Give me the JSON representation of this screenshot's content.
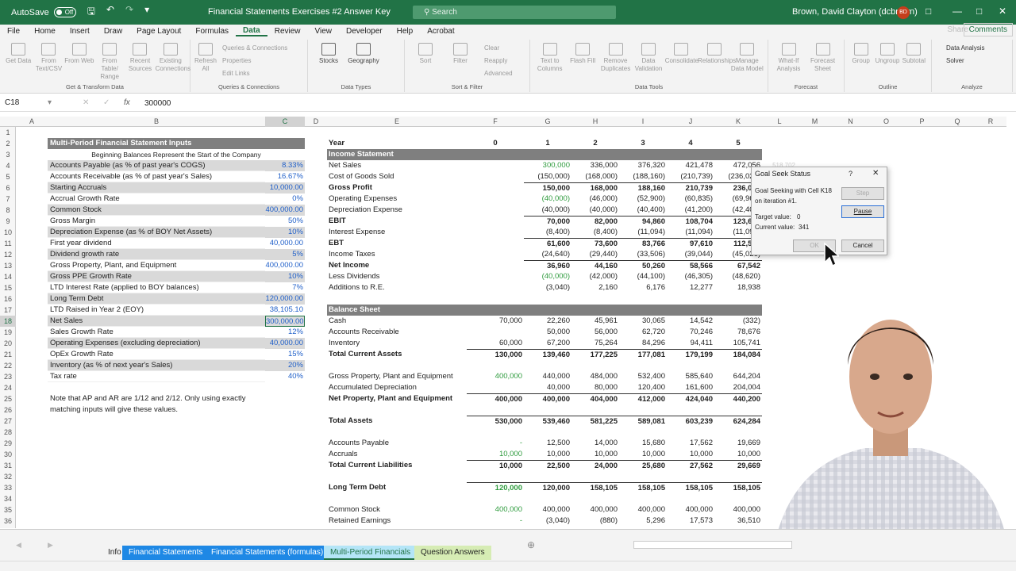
{
  "titlebar": {
    "autosave_label": "AutoSave",
    "autosave_state": "Off",
    "doc_title": "Financial Statements Exercises #2 Answer Key",
    "search_placeholder": "Search",
    "user_name": "Brown, David Clayton (dcbrown)",
    "user_initials": "BD"
  },
  "menu": {
    "items": [
      "File",
      "Home",
      "Insert",
      "Draw",
      "Page Layout",
      "Formulas",
      "Data",
      "Review",
      "View",
      "Developer",
      "Help",
      "Acrobat"
    ],
    "active": "Data",
    "share": "Share",
    "comments": "Comments"
  },
  "ribbon": {
    "get_transform": {
      "name": "Get & Transform Data",
      "buttons": [
        "Get Data",
        "From Text/CSV",
        "From Web",
        "From Table/ Range",
        "Recent Sources",
        "Existing Connections"
      ]
    },
    "queries": {
      "name": "Queries & Connections",
      "refresh": "Refresh All",
      "small": [
        "Queries & Connections",
        "Properties",
        "Edit Links"
      ]
    },
    "data_types": {
      "name": "Data Types",
      "buttons": [
        "Stocks",
        "Geography"
      ]
    },
    "sort_filter": {
      "name": "Sort & Filter",
      "buttons": [
        "Sort",
        "Filter"
      ],
      "small": [
        "Clear",
        "Reapply",
        "Advanced"
      ]
    },
    "data_tools": {
      "name": "Data Tools",
      "buttons": [
        "Text to Columns",
        "Flash Fill",
        "Remove Duplicates",
        "Data Validation",
        "Consolidate",
        "Relationships",
        "Manage Data Model"
      ]
    },
    "forecast": {
      "name": "Forecast",
      "buttons": [
        "What-If Analysis",
        "Forecast Sheet"
      ]
    },
    "outline": {
      "name": "Outline",
      "buttons": [
        "Group",
        "Ungroup",
        "Subtotal"
      ]
    },
    "analyze": {
      "name": "Analyze",
      "small": [
        "Data Analysis",
        "Solver"
      ]
    }
  },
  "formula_bar": {
    "name_box": "C18",
    "fx": "fx",
    "value": "300000"
  },
  "columns": [
    "A",
    "B",
    "C",
    "D",
    "E",
    "F",
    "G",
    "H",
    "I",
    "J",
    "K",
    "L",
    "M",
    "N",
    "O",
    "P",
    "Q",
    "R"
  ],
  "rows": [
    "1",
    "2",
    "3",
    "4",
    "5",
    "6",
    "7",
    "8",
    "9",
    "10",
    "11",
    "12",
    "13",
    "14",
    "15",
    "16",
    "17",
    "18",
    "19",
    "20",
    "21",
    "22",
    "23",
    "24",
    "25",
    "26",
    "27",
    "28",
    "29",
    "30",
    "31",
    "32",
    "33",
    "34",
    "35",
    "36"
  ],
  "inputs": {
    "title": "Multi-Period Financial Statement Inputs",
    "subtitle": "Beginning Balances Represent the Start of the Company",
    "rows": [
      {
        "label": "Accounts Payable (as % of past year's COGS)",
        "value": "8.33%"
      },
      {
        "label": "Accounts Receivable (as % of past year's Sales)",
        "value": "16.67%"
      },
      {
        "label": "Starting Accruals",
        "value": "10,000.00"
      },
      {
        "label": "Accrual Growth Rate",
        "value": "0%"
      },
      {
        "label": "Common Stock",
        "value": "400,000.00"
      },
      {
        "label": "Gross Margin",
        "value": "50%"
      },
      {
        "label": "Depreciation Expense (as % of BOY Net Assets)",
        "value": "10%"
      },
      {
        "label": "First year dividend",
        "value": "40,000.00"
      },
      {
        "label": "Dividend growth rate",
        "value": "5%"
      },
      {
        "label": "Gross Property, Plant, and Equipment",
        "value": "400,000.00"
      },
      {
        "label": "Gross PPE Growth Rate",
        "value": "10%"
      },
      {
        "label": "LTD Interest Rate (applied to BOY balances)",
        "value": "7%"
      },
      {
        "label": "Long Term Debt",
        "value": "120,000.00"
      },
      {
        "label": "LTD Raised in Year 2 (EOY)",
        "value": "38,105.10"
      },
      {
        "label": "Net Sales",
        "value": "300,000.00"
      },
      {
        "label": "Sales Growth Rate",
        "value": "12%"
      },
      {
        "label": "Operating Expenses (excluding depreciation)",
        "value": "40,000.00"
      },
      {
        "label": "OpEx Growth Rate",
        "value": "15%"
      },
      {
        "label": "Inventory (as % of next year's Sales)",
        "value": "20%"
      },
      {
        "label": "Tax rate",
        "value": "40%"
      }
    ],
    "note_line1": "Note that AP and AR are 1/12 and 2/12. Only using exactly",
    "note_line2": "matching inputs will give these values."
  },
  "statements": {
    "year_label": "Year",
    "years": [
      "0",
      "1",
      "2",
      "3",
      "4",
      "5"
    ],
    "income_header": "Income Statement",
    "income": [
      {
        "label": "Net Sales",
        "vals": [
          "",
          "300,000",
          "336,000",
          "376,320",
          "421,478",
          "472,056"
        ],
        "bold": false
      },
      {
        "label": "Cost of Goods Sold",
        "vals": [
          "",
          "(150,000)",
          "(168,000)",
          "(188,160)",
          "(210,739)",
          "(236,028)"
        ],
        "bold": false
      },
      {
        "label": "Gross Profit",
        "vals": [
          "",
          "150,000",
          "168,000",
          "188,160",
          "210,739",
          "236,028"
        ],
        "bold": true
      },
      {
        "label": "Operating Expenses",
        "vals": [
          "",
          "(40,000)",
          "(46,000)",
          "(52,900)",
          "(60,835)",
          "(69,960)"
        ],
        "bold": false
      },
      {
        "label": "Depreciation Expense",
        "vals": [
          "",
          "(40,000)",
          "(40,000)",
          "(40,400)",
          "(41,200)",
          "(42,409)"
        ],
        "bold": false
      },
      {
        "label": "EBIT",
        "vals": [
          "",
          "70,000",
          "82,000",
          "94,860",
          "108,704",
          "123,659"
        ],
        "bold": true
      },
      {
        "label": "Interest Expense",
        "vals": [
          "",
          "(8,400)",
          "(8,400)",
          "(11,094)",
          "(11,094)",
          "(11,094)"
        ],
        "bold": false
      },
      {
        "label": "EBT",
        "vals": [
          "",
          "61,600",
          "73,600",
          "83,766",
          "97,610",
          "112,565"
        ],
        "bold": true
      },
      {
        "label": "Income Taxes",
        "vals": [
          "",
          "(24,640)",
          "(29,440)",
          "(33,506)",
          "(39,044)",
          "(45,026)"
        ],
        "bold": false
      },
      {
        "label": "Net Income",
        "vals": [
          "",
          "36,960",
          "44,160",
          "50,260",
          "58,566",
          "67,542"
        ],
        "bold": true
      },
      {
        "label": "Less Dividends",
        "vals": [
          "",
          "(40,000)",
          "(42,000)",
          "(44,100)",
          "(46,305)",
          "(48,620)"
        ],
        "bold": false
      },
      {
        "label": "Additions to R.E.",
        "vals": [
          "",
          "(3,040)",
          "2,160",
          "6,176",
          "12,277",
          "18,938"
        ],
        "bold": false
      }
    ],
    "balance_header": "Balance Sheet",
    "balance": [
      {
        "row": 18,
        "label": "Cash",
        "vals": [
          "70,000",
          "22,260",
          "45,961",
          "30,065",
          "14,542",
          "(332)"
        ],
        "bold": false
      },
      {
        "row": 19,
        "label": "Accounts Receivable",
        "vals": [
          "",
          "50,000",
          "56,000",
          "62,720",
          "70,246",
          "78,676"
        ],
        "bold": false
      },
      {
        "row": 20,
        "label": "Inventory",
        "vals": [
          "60,000",
          "67,200",
          "75,264",
          "84,296",
          "94,411",
          "105,741"
        ],
        "bold": false
      },
      {
        "row": 21,
        "label": "Total Current Assets",
        "vals": [
          "130,000",
          "139,460",
          "177,225",
          "177,081",
          "179,199",
          "184,084"
        ],
        "bold": true
      },
      {
        "row": 23,
        "label": "Gross Property, Plant and Equipment",
        "vals": [
          "400,000",
          "440,000",
          "484,000",
          "532,400",
          "585,640",
          "644,204"
        ],
        "bold": false
      },
      {
        "row": 24,
        "label": "Accumulated Depreciation",
        "vals": [
          "",
          "40,000",
          "80,000",
          "120,400",
          "161,600",
          "204,004"
        ],
        "bold": false
      },
      {
        "row": 25,
        "label": "Net Property, Plant and Equipment",
        "vals": [
          "400,000",
          "400,000",
          "404,000",
          "412,000",
          "424,040",
          "440,200"
        ],
        "bold": true
      },
      {
        "row": 27,
        "label": "Total Assets",
        "vals": [
          "530,000",
          "539,460",
          "581,225",
          "589,081",
          "603,239",
          "624,284"
        ],
        "bold": true
      },
      {
        "row": 29,
        "label": "Accounts Payable",
        "vals": [
          "-",
          "12,500",
          "14,000",
          "15,680",
          "17,562",
          "19,669"
        ],
        "bold": false
      },
      {
        "row": 30,
        "label": "Accruals",
        "vals": [
          "10,000",
          "10,000",
          "10,000",
          "10,000",
          "10,000",
          "10,000"
        ],
        "bold": false
      },
      {
        "row": 31,
        "label": "Total Current Liabilities",
        "vals": [
          "10,000",
          "22,500",
          "24,000",
          "25,680",
          "27,562",
          "29,669"
        ],
        "bold": true
      },
      {
        "row": 33,
        "label": "Long Term Debt",
        "vals": [
          "120,000",
          "120,000",
          "158,105",
          "158,105",
          "158,105",
          "158,105"
        ],
        "bold": true
      },
      {
        "row": 35,
        "label": "Common Stock",
        "vals": [
          "400,000",
          "400,000",
          "400,000",
          "400,000",
          "400,000",
          "400,000"
        ],
        "bold": false
      },
      {
        "row": 36,
        "label": "Retained Earnings",
        "vals": [
          "-",
          "(3,040)",
          "(880)",
          "5,296",
          "17,573",
          "36,510"
        ],
        "bold": false
      }
    ],
    "l4_faded": "518,702"
  },
  "dialog": {
    "title": "Goal Seek Status",
    "line1": "Goal Seeking with Cell K18",
    "line2": "on iteration #1.",
    "target_label": "Target value:",
    "target_value": "0",
    "current_label": "Current value:",
    "current_value": "341",
    "step": "Step",
    "pause": "Pause",
    "ok": "OK",
    "cancel": "Cancel",
    "help": "?",
    "close": "✕"
  },
  "sheet_tabs": [
    "Info",
    "Financial Statements",
    "Financial Statements (formulas)",
    "Multi-Period Financials",
    "Question Answers"
  ],
  "active_sheet": "Multi-Period Financials",
  "colors": {
    "excel_green": "#217346",
    "input_blue": "#1f5fc9",
    "header_gray": "#7f7f7f",
    "tab_blue": "#1e88e5",
    "tab_active": "#b4e5f7",
    "tab_answers": "#d6ecb4"
  }
}
